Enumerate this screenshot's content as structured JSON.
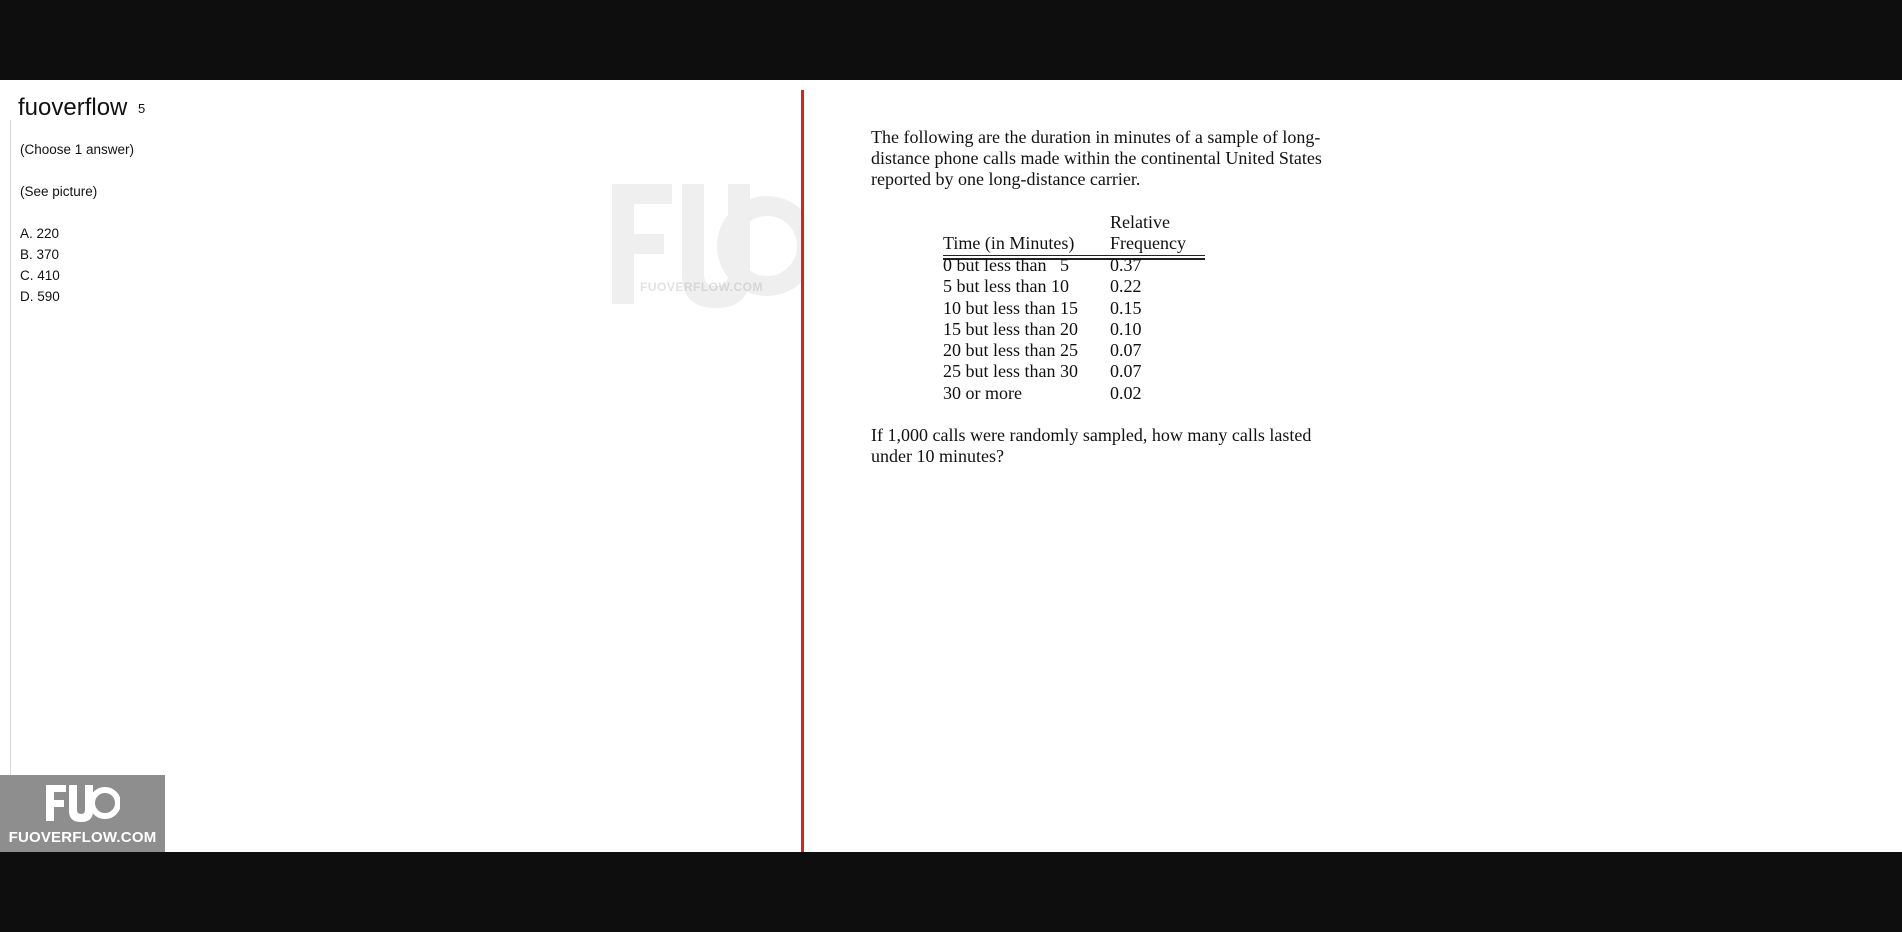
{
  "site": {
    "name": "fuoverflow",
    "name_overflow": "5"
  },
  "question": {
    "instruction": "(Choose 1 answer)",
    "see_picture": "(See picture)",
    "answers": [
      "A. 220",
      "B. 370",
      "C. 410",
      "D. 590"
    ]
  },
  "watermark": {
    "text": "FUOVERFLOW.COM"
  },
  "picture": {
    "intro_lines": [
      "The following are the duration in minutes of a sample of long-",
      "distance phone calls made within the continental United States",
      "reported by one long-distance carrier."
    ],
    "table": {
      "header_top": "Relative",
      "col1_header": "Time (in Minutes)",
      "col2_header": "Frequency",
      "rows": [
        {
          "time": "0 but less than   5",
          "freq": "0.37"
        },
        {
          "time": "5 but less than 10",
          "freq": "0.22"
        },
        {
          "time": "10 but less than 15",
          "freq": "0.15"
        },
        {
          "time": "15 but less than 20",
          "freq": "0.10"
        },
        {
          "time": "20 but less than 25",
          "freq": "0.07"
        },
        {
          "time": "25 but less than 30",
          "freq": "0.07"
        },
        {
          "time": "30 or more",
          "freq": "0.02"
        }
      ]
    },
    "question_lines": [
      "If 1,000 calls were randomly sampled, how many calls lasted",
      "under 10 minutes?"
    ]
  },
  "logo": {
    "mark": "FUO",
    "text": "FUOVERFLOW.COM"
  },
  "colors": {
    "divider": "#e01f1f",
    "letterbox": "#0e0e0e",
    "logo_bg": "#8e8e8e"
  }
}
